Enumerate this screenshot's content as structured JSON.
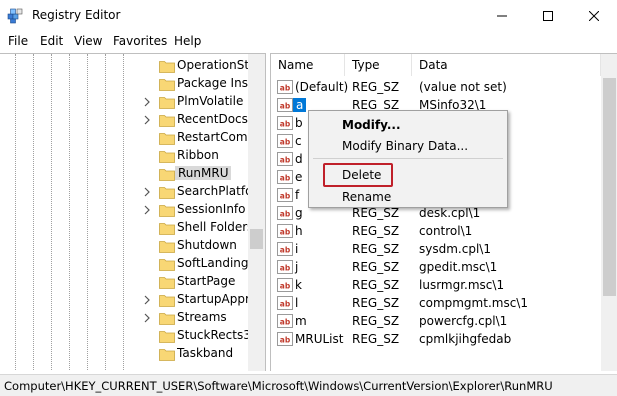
{
  "window": {
    "title": "Registry Editor"
  },
  "menu": [
    "File",
    "Edit",
    "View",
    "Favorites",
    "Help"
  ],
  "tree": {
    "items": [
      {
        "label": "OperationSta",
        "expander": false
      },
      {
        "label": "Package Insta",
        "expander": false
      },
      {
        "label": "PlmVolatile",
        "expander": true
      },
      {
        "label": "RecentDocs",
        "expander": true
      },
      {
        "label": "RestartComm",
        "expander": false
      },
      {
        "label": "Ribbon",
        "expander": false
      },
      {
        "label": "RunMRU",
        "expander": false,
        "selected": true
      },
      {
        "label": "SearchPlatfor",
        "expander": true
      },
      {
        "label": "SessionInfo",
        "expander": true
      },
      {
        "label": "Shell Folders",
        "expander": false
      },
      {
        "label": "Shutdown",
        "expander": false
      },
      {
        "label": "SoftLanding",
        "expander": false
      },
      {
        "label": "StartPage",
        "expander": false
      },
      {
        "label": "StartupAppro",
        "expander": true
      },
      {
        "label": "Streams",
        "expander": true
      },
      {
        "label": "StuckRects3",
        "expander": false
      },
      {
        "label": "Taskband",
        "expander": false
      }
    ]
  },
  "list": {
    "columns": {
      "name": "Name",
      "type": "Type",
      "data": "Data"
    },
    "rows": [
      {
        "name": "(Default)",
        "type": "REG_SZ",
        "data": "(value not set)"
      },
      {
        "name": "a",
        "type": "REG_SZ",
        "data": "MSinfo32\\1",
        "selected": true
      },
      {
        "name": "b",
        "type": "",
        "data": ""
      },
      {
        "name": "c",
        "type": "",
        "data": ""
      },
      {
        "name": "d",
        "type": "",
        "data": ""
      },
      {
        "name": "e",
        "type": "",
        "data": ""
      },
      {
        "name": "f",
        "type": "",
        "data": ""
      },
      {
        "name": "g",
        "type": "REG_SZ",
        "data": "desk.cpl\\1"
      },
      {
        "name": "h",
        "type": "REG_SZ",
        "data": "control\\1"
      },
      {
        "name": "i",
        "type": "REG_SZ",
        "data": "sysdm.cpl\\1"
      },
      {
        "name": "j",
        "type": "REG_SZ",
        "data": "gpedit.msc\\1"
      },
      {
        "name": "k",
        "type": "REG_SZ",
        "data": "lusrmgr.msc\\1"
      },
      {
        "name": "l",
        "type": "REG_SZ",
        "data": "compmgmt.msc\\1"
      },
      {
        "name": "m",
        "type": "REG_SZ",
        "data": "powercfg.cpl\\1"
      },
      {
        "name": "MRUList",
        "type": "REG_SZ",
        "data": "cpmlkjihgfedab"
      }
    ]
  },
  "context_menu": {
    "modify": "Modify...",
    "modify_binary": "Modify Binary Data...",
    "delete": "Delete",
    "rename": "Rename"
  },
  "status": {
    "path": "Computer\\HKEY_CURRENT_USER\\Software\\Microsoft\\Windows\\CurrentVersion\\Explorer\\RunMRU"
  },
  "colors": {
    "selection": "#0078d7",
    "highlight_box": "#c0202a",
    "folder": "#f8d775"
  }
}
